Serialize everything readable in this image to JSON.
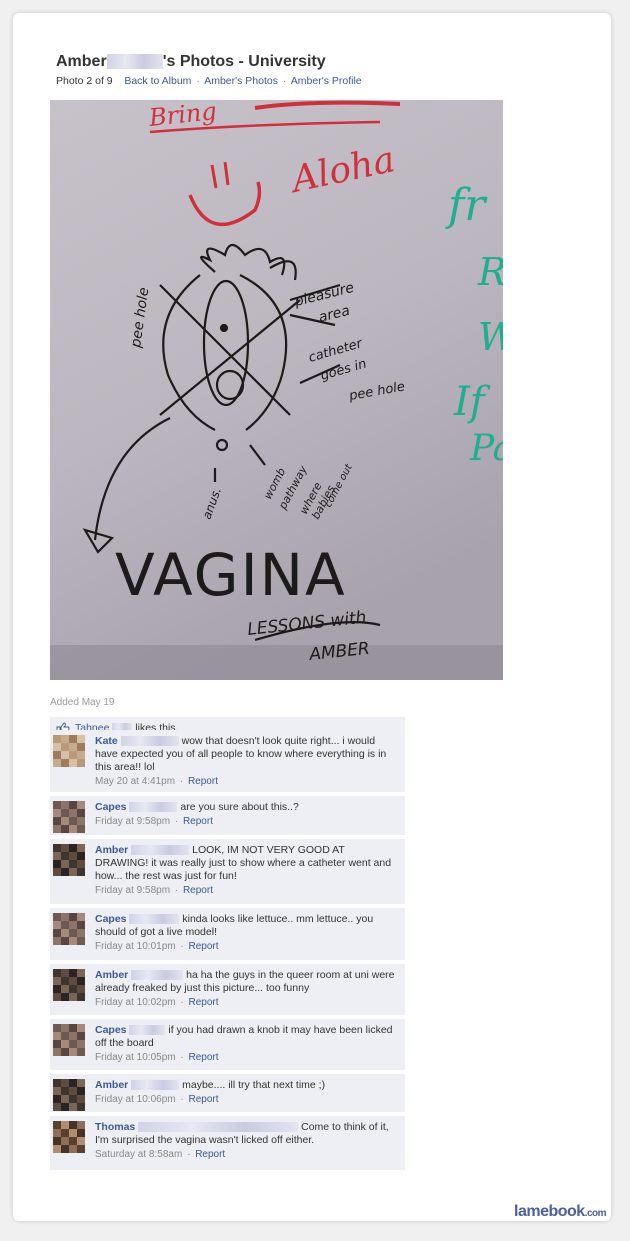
{
  "header": {
    "title_first": "Amber",
    "title_rest": "'s Photos - University",
    "photo_position": "Photo 2 of 9",
    "back_to_album": "Back to Album",
    "ambers_photos": "Amber's Photos",
    "ambers_profile": "Amber's Profile"
  },
  "photo": {
    "text_bring": "Bring",
    "text_aloha": "Aloha",
    "text_peehole": "pee hole",
    "text_pleasure": "pleasure",
    "text_area": "area",
    "text_catheter1": "catheter",
    "text_catheter2": "goes in",
    "text_catheter3": "pee hole",
    "text_anus": "anus.",
    "text_womb1": "womb",
    "text_womb2": "pathway",
    "text_womb3": "where",
    "text_womb4": "babies",
    "text_womb5": "come out",
    "text_vagina": "VAGINA",
    "text_lessons": "LESSONS with",
    "text_amber": "AMBER",
    "text_green1": "fr",
    "text_green2": "R",
    "text_green3": "W",
    "text_green4": "If",
    "text_green5": "Pa"
  },
  "added": "Added May 19",
  "likes": {
    "name": "Tahnee",
    "text": "likes this."
  },
  "comments": [
    {
      "name": "Kate",
      "text": "wow that doesn't look quite right... i would have expected you of all people to know where everything is in this area!! lol",
      "time": "May 20 at 4:41pm",
      "report": "Report"
    },
    {
      "name": "Capes",
      "text": "are you sure about this..?",
      "time": "Friday at 9:58pm",
      "report": "Report"
    },
    {
      "name": "Amber",
      "text": "LOOK, IM NOT VERY GOOD AT DRAWING! it was really just to show where a catheter went and how... the rest was just for fun!",
      "time": "Friday at 9:58pm",
      "report": "Report"
    },
    {
      "name": "Capes",
      "text": "kinda looks like lettuce.. mm lettuce.. you should of got a live model!",
      "time": "Friday at 10:01pm",
      "report": "Report"
    },
    {
      "name": "Amber",
      "text": "ha ha the guys in the queer room at uni were already freaked by just this picture... too funny",
      "time": "Friday at 10:02pm",
      "report": "Report"
    },
    {
      "name": "Capes",
      "text": "if you had drawn a knob it may have been licked off the board",
      "time": "Friday at 10:05pm",
      "report": "Report"
    },
    {
      "name": "Amber",
      "text": "maybe.... ill try that next time ;)",
      "time": "Friday at 10:06pm",
      "report": "Report"
    },
    {
      "name": "Thomas",
      "text": "Come to think of it, I'm surprised the vagina wasn't licked off either.",
      "time": "Saturday at 8:58am",
      "report": "Report"
    }
  ],
  "brand": {
    "name": "lamebook",
    "suffix": ".com"
  },
  "colors": {
    "link": "#3b5998",
    "comment_bg": "#edeff4",
    "marker_red": "#d22f3c",
    "marker_green": "#1fae8e",
    "ink": "#1b1b1b"
  }
}
